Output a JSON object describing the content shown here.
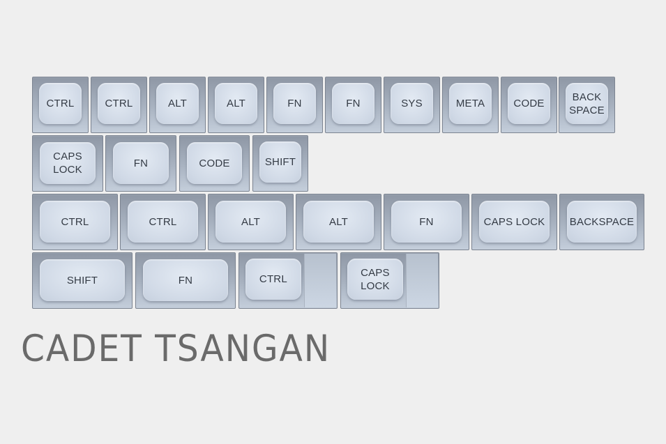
{
  "title": "CADET TSANGAN",
  "colors": {
    "background": "#efefef",
    "keycap_top": "#d3dce8",
    "keycap_side": "#9ca6b4",
    "legend": "#333a44",
    "title": "#6a6a6a"
  },
  "rows": [
    {
      "keys": [
        {
          "label": "CTRL"
        },
        {
          "label": "CTRL"
        },
        {
          "label": "ALT"
        },
        {
          "label": "ALT"
        },
        {
          "label": "FN"
        },
        {
          "label": "FN"
        },
        {
          "label": "SYS"
        },
        {
          "label": "META"
        },
        {
          "label": "CODE"
        },
        {
          "label": "BACK\nSPACE"
        }
      ]
    },
    {
      "keys": [
        {
          "label": "CAPS\nLOCK"
        },
        {
          "label": "FN"
        },
        {
          "label": "CODE"
        },
        {
          "label": "SHIFT"
        }
      ]
    },
    {
      "keys": [
        {
          "label": "CTRL"
        },
        {
          "label": "CTRL"
        },
        {
          "label": "ALT"
        },
        {
          "label": "ALT"
        },
        {
          "label": "FN"
        },
        {
          "label": "CAPS LOCK"
        },
        {
          "label": "BACKSPACE"
        }
      ]
    },
    {
      "keys": [
        {
          "label": "SHIFT"
        },
        {
          "label": "FN"
        },
        {
          "label": "CTRL",
          "stepped": true
        },
        {
          "label": "CAPS\nLOCK",
          "stepped": true
        }
      ]
    }
  ]
}
